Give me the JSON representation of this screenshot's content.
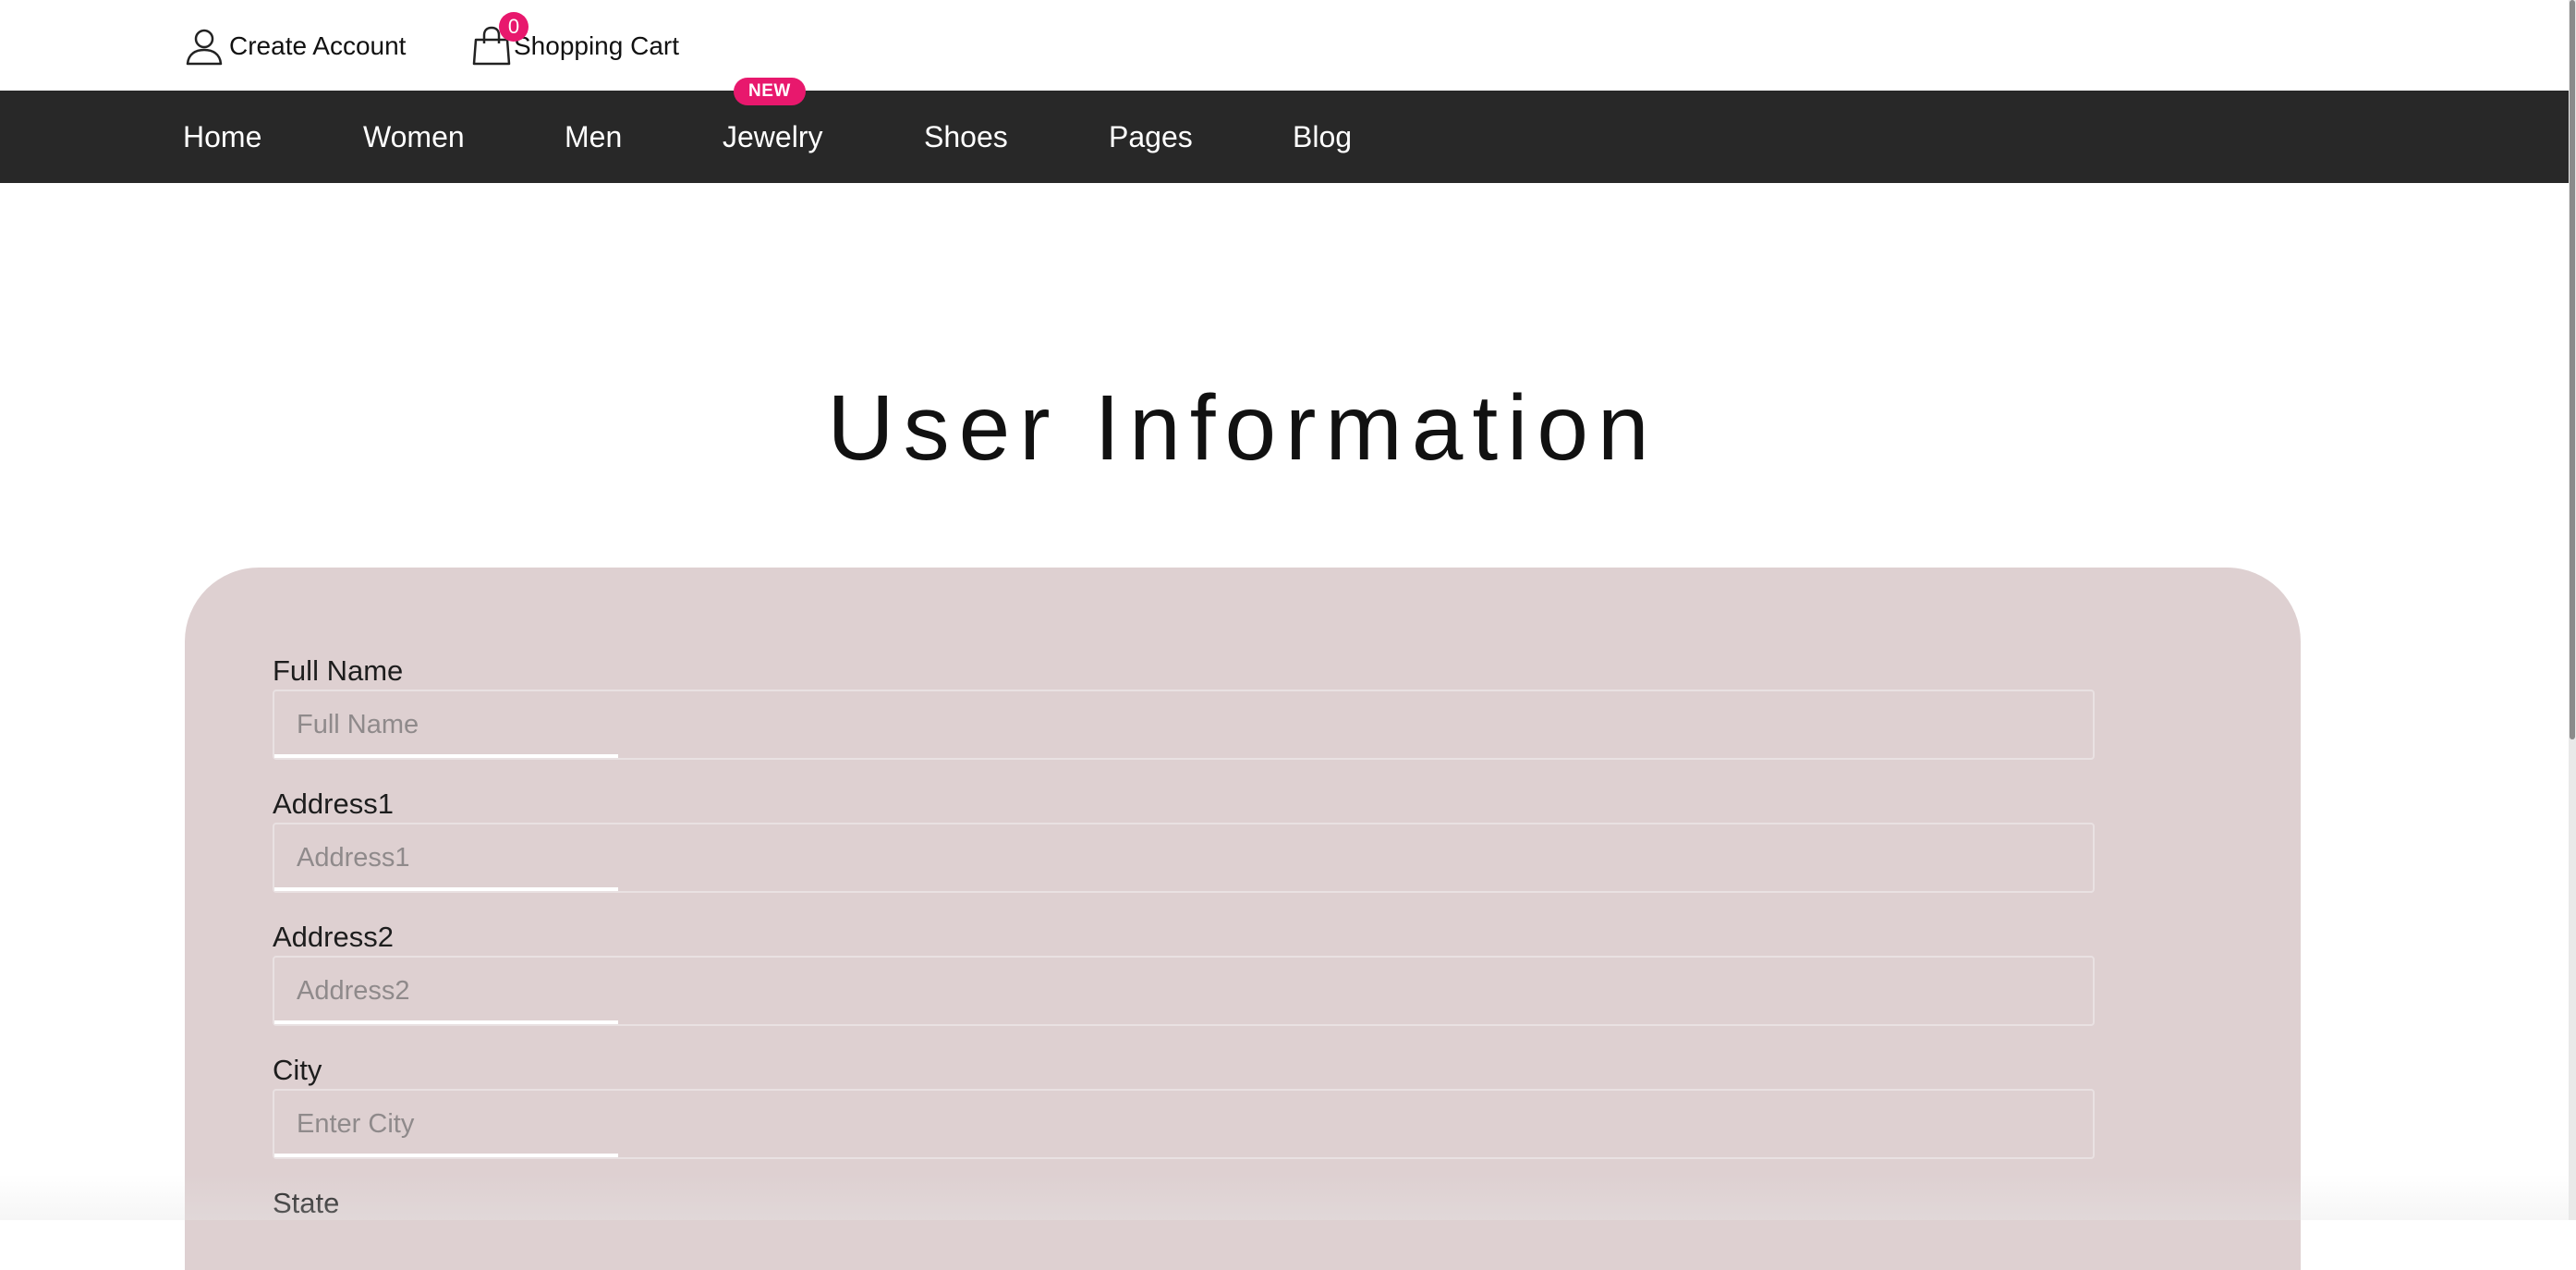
{
  "header": {
    "create_account": "Create Account",
    "shopping_cart": "Shopping Cart",
    "cart_count": "0"
  },
  "nav": {
    "items": [
      "Home",
      "Women",
      "Men",
      "Jewelry",
      "Shoes",
      "Pages",
      "Blog"
    ],
    "badge": "NEW"
  },
  "page": {
    "title": "User Information"
  },
  "form": {
    "fields": [
      {
        "label": "Full Name",
        "placeholder": "Full Name",
        "value": ""
      },
      {
        "label": "Address1",
        "placeholder": "Address1",
        "value": ""
      },
      {
        "label": "Address2",
        "placeholder": "Address2",
        "value": ""
      },
      {
        "label": "City",
        "placeholder": "Enter City",
        "value": ""
      },
      {
        "label": "State",
        "placeholder": "",
        "value": ""
      }
    ]
  },
  "colors": {
    "accent": "#e8186d",
    "nav_bg": "#282828",
    "card_bg": "#ded0d1"
  }
}
